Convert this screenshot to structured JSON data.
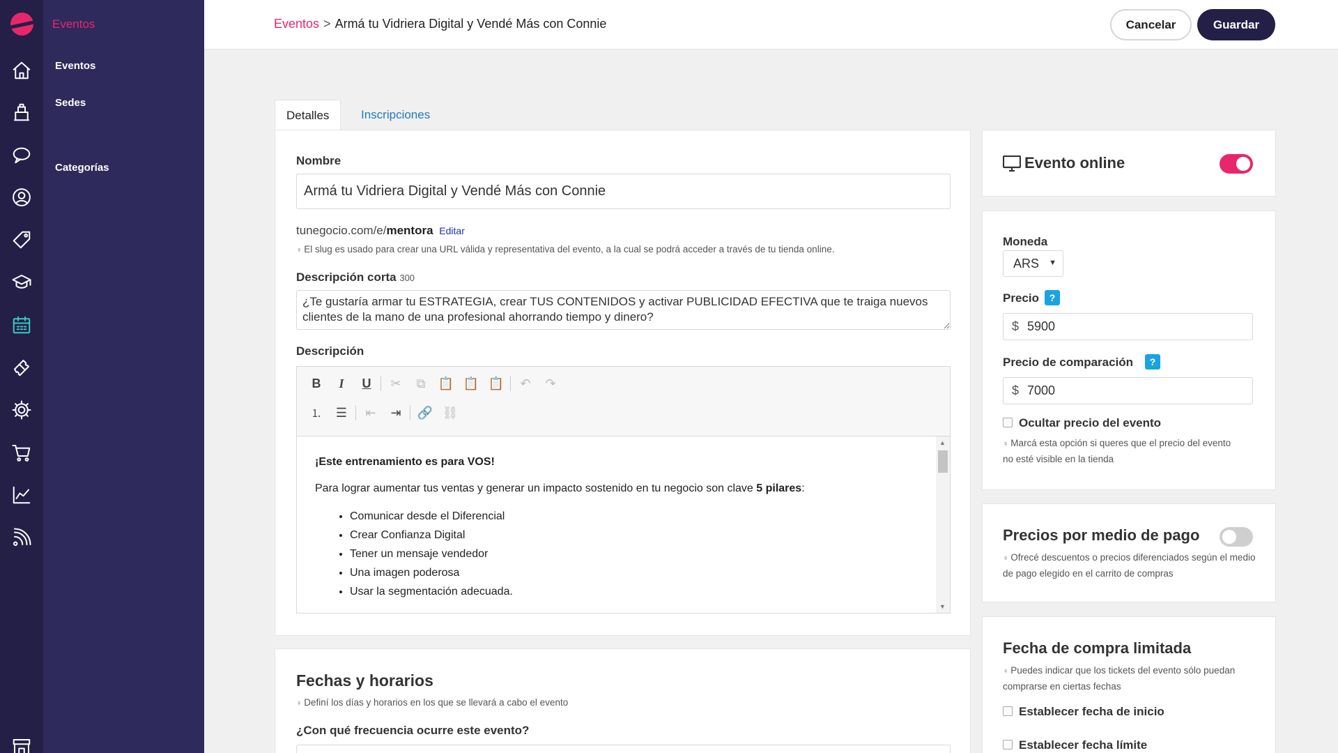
{
  "app": {
    "section_title": "Eventos"
  },
  "subnav": {
    "items": [
      "Eventos",
      "Sedes",
      "Categorías"
    ]
  },
  "topbar": {
    "breadcrumb_root": "Eventos",
    "breadcrumb_separator": ">",
    "breadcrumb_current": "Armá tu Vidriera Digital y Vendé Más con Connie",
    "cancel_label": "Cancelar",
    "save_label": "Guardar"
  },
  "tabs": [
    "Detalles",
    "Inscripciones"
  ],
  "details": {
    "name_label": "Nombre",
    "name_value": "Armá tu Vidriera Digital y Vendé Más con Connie",
    "slug_prefix": "tunegocio.com/e/",
    "slug_value": "mentora",
    "slug_edit": "Editar",
    "slug_hint": "El slug es usado para crear una URL válida y representativa del evento, a la cual se podrá acceder a través de tu tienda online.",
    "short_desc_label": "Descripción corta",
    "short_desc_count": "300",
    "short_desc_value": "¿Te gustaría armar tu ESTRATEGIA, crear TUS CONTENIDOS y activar PUBLICIDAD EFECTIVA que te traiga nuevos clientes de la mano de una profesional ahorrando tiempo y dinero?",
    "desc_label": "Descripción",
    "editor": {
      "heading": "¡Este entrenamiento es para VOS!",
      "paragraph_start": "Para lograr aumentar tus ventas y generar un impacto sostenido en tu negocio son clave ",
      "paragraph_bold": "5 pilares",
      "paragraph_end": ":",
      "bullets": [
        "Comunicar desde el Diferencial",
        "Crear Confianza Digital",
        "Tener un mensaje vendedor",
        "Una imagen poderosa",
        "Usar la segmentación adecuada."
      ]
    }
  },
  "dates": {
    "title": "Fechas y horarios",
    "hint": "Definí los días y horarios en los que se llevará a cabo el evento",
    "frequency_label": "¿Con qué frecuencia ocurre este evento?"
  },
  "online": {
    "label": "Evento online",
    "enabled": true
  },
  "pricing": {
    "currency_label": "Moneda",
    "currency_value": "ARS",
    "price_label": "Precio",
    "price_symbol": "$",
    "price_value": "5900",
    "compare_label": "Precio de comparación",
    "compare_value": "7000",
    "help_badge": "?",
    "hide_label": "Ocultar precio del evento",
    "hide_hint": "Marcá esta opción si queres que el precio del evento no esté visible en la tienda"
  },
  "payment_prices": {
    "title": "Precios por medio de pago",
    "enabled": false,
    "hint": "Ofrecé descuentos o precios diferenciados según el medio de pago elegido en el carrito de compras"
  },
  "limited_date": {
    "title": "Fecha de compra limitada",
    "hint": "Puedes indicar que los tickets del evento sólo puedan comprarse en ciertas fechas",
    "start_label": "Establecer fecha de inicio",
    "end_label": "Establecer fecha límite"
  },
  "icons": [
    "home-icon",
    "store-icon",
    "chat-icon",
    "user-icon",
    "tag-icon",
    "graduation-cap-icon",
    "calendar-icon",
    "ticket-icon",
    "gear-icon",
    "cart-icon",
    "chart-icon",
    "rss-icon",
    "shop-icon"
  ],
  "colors": {
    "brand": "#e8266b",
    "sidebar": "#231f47",
    "subnav": "#2e2a5c",
    "link": "#1f7ac7",
    "accent": "#3ec9c1"
  }
}
